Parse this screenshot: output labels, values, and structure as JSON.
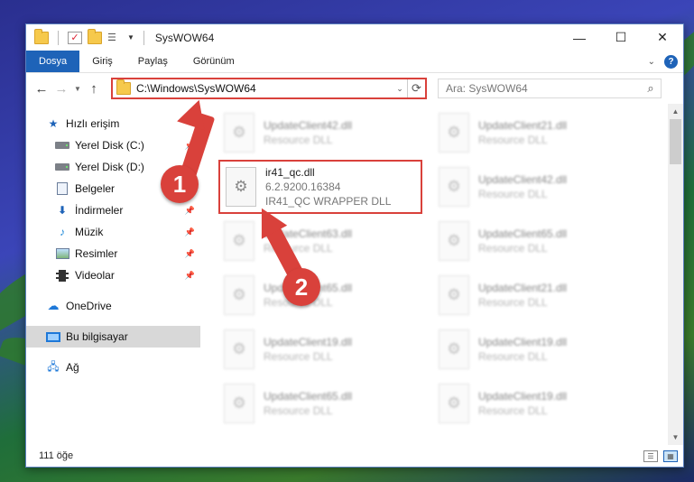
{
  "window": {
    "title": "SysWOW64"
  },
  "window_controls": {
    "minimize": "—",
    "maximize": "☐",
    "close": "✕"
  },
  "ribbon": {
    "tabs": [
      "Dosya",
      "Giriş",
      "Paylaş",
      "Görünüm"
    ],
    "help": "?"
  },
  "navigation": {
    "address": "C:\\Windows\\SysWOW64",
    "search_placeholder": "Ara: SysWOW64"
  },
  "sidebar": {
    "items": [
      {
        "label": "Hızlı erişim"
      },
      {
        "label": "Yerel Disk (C:)"
      },
      {
        "label": "Yerel Disk (D:)"
      },
      {
        "label": "Belgeler"
      },
      {
        "label": "İndirmeler"
      },
      {
        "label": "Müzik"
      },
      {
        "label": "Resimler"
      },
      {
        "label": "Videolar"
      },
      {
        "label": "OneDrive"
      },
      {
        "label": "Bu bilgisayar"
      },
      {
        "label": "Ağ"
      }
    ]
  },
  "files": [
    {
      "name": "UpdateClient42.dll",
      "sub": "Resource DLL"
    },
    {
      "name": "UpdateClient21.dll",
      "sub": "Resource DLL"
    },
    {
      "name": "ir41_qc.dll",
      "version": "6.2.9200.16384",
      "description": "IR41_QC WRAPPER DLL"
    },
    {
      "name": "UpdateClient42.dll",
      "sub": "Resource DLL"
    },
    {
      "name": "UpdateClient63.dll",
      "sub": "Resource DLL"
    },
    {
      "name": "UpdateClient65.dll",
      "sub": "Resource DLL"
    },
    {
      "name": "UpdateClient65.dll",
      "sub": "Resource DLL"
    },
    {
      "name": "UpdateClient21.dll",
      "sub": "Resource DLL"
    },
    {
      "name": "UpdateClient19.dll",
      "sub": "Resource DLL"
    },
    {
      "name": "UpdateClient19.dll",
      "sub": "Resource DLL"
    },
    {
      "name": "UpdateClient65.dll",
      "sub": "Resource DLL"
    },
    {
      "name": "UpdateClient19.dll",
      "sub": "Resource DLL"
    }
  ],
  "status": {
    "item_count": "111 öğe"
  },
  "annotations": {
    "step1": "1",
    "step2": "2",
    "color": "#d9413b"
  }
}
